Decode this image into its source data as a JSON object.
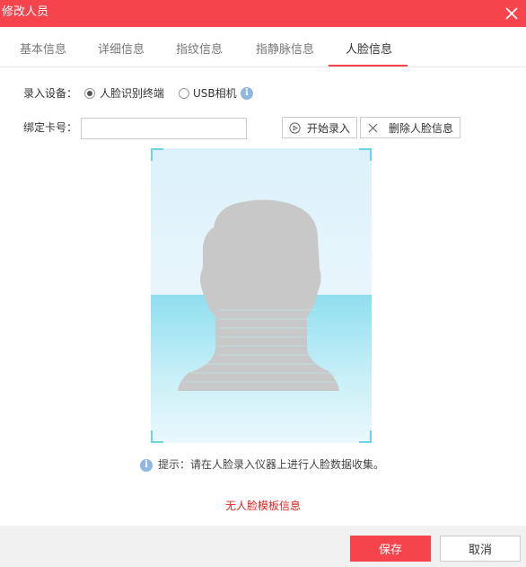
{
  "dialog": {
    "title": "修改人员"
  },
  "tabs": [
    {
      "label": "基本信息"
    },
    {
      "label": "详细信息"
    },
    {
      "label": "指纹信息"
    },
    {
      "label": "指静脉信息"
    },
    {
      "label": "人脸信息",
      "active": true
    }
  ],
  "device": {
    "label": "录入设备：",
    "options": [
      {
        "label": "人脸识别终端",
        "checked": true
      },
      {
        "label": "USB相机",
        "checked": false
      }
    ]
  },
  "card": {
    "label": "绑定卡号：",
    "value": "",
    "placeholder": ""
  },
  "actions": {
    "start_label": "开始录入",
    "delete_label": "删除人脸信息"
  },
  "hint": {
    "text": "提示：请在人脸录入仪器上进行人脸数据收集。"
  },
  "status": {
    "no_face_text": "无人脸模板信息"
  },
  "footer": {
    "save_label": "保存",
    "cancel_label": "取消"
  },
  "colors": {
    "accent": "#f5444b",
    "error": "#e0231f",
    "info": "#8fb8e0"
  },
  "icons": {
    "close": "close-icon",
    "info": "info-icon",
    "play": "play-circle-icon",
    "delete": "x-icon"
  }
}
